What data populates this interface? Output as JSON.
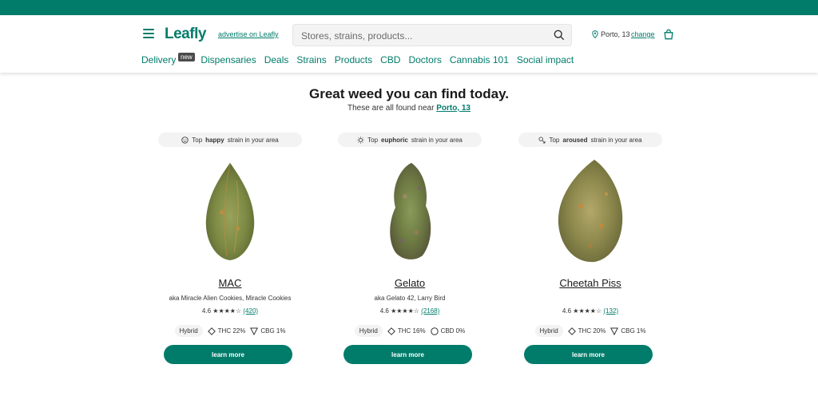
{
  "colors": {
    "brand": "#017c6b",
    "badge": "#4a4a4a"
  },
  "header": {
    "logo": "Leafly",
    "advertise": "advertise on Leafly",
    "search_placeholder": "Stores, strains, products...",
    "location": "Porto, 13",
    "change": "change",
    "icons": [
      "menu-icon",
      "search-icon",
      "location-pin-icon",
      "shopping-bag-icon"
    ]
  },
  "nav": {
    "items": [
      "Delivery",
      "Dispensaries",
      "Deals",
      "Strains",
      "Products",
      "CBD",
      "Doctors",
      "Cannabis 101",
      "Social impact"
    ],
    "badge": "new"
  },
  "hero": {
    "title": "Great weed you can find today.",
    "subtitle_prefix": "These are all found near",
    "subtitle_link": "Porto, 13"
  },
  "cards": [
    {
      "tag_prefix": "Top",
      "tag_bold": "happy",
      "tag_suffix": "strain in your area",
      "tag_icon": "smiley-icon",
      "name": "MAC",
      "aka": "aka Miracle Alien Cookies, Miracle Cookies",
      "rating": "4.6",
      "count": "(420)",
      "type": "Hybrid",
      "thc": "THC 22%",
      "cb": "CBG 1%",
      "cb_icon": "triangle-icon",
      "button": "learn more"
    },
    {
      "tag_prefix": "Top",
      "tag_bold": "euphoric",
      "tag_suffix": "strain in your area",
      "tag_icon": "sun-icon",
      "name": "Gelato",
      "aka": "aka Gelato 42, Larry Bird",
      "rating": "4.6",
      "count": "(2168)",
      "type": "Hybrid",
      "thc": "THC 16%",
      "cb": "CBD 0%",
      "cb_icon": "circle-icon",
      "button": "learn more"
    },
    {
      "tag_prefix": "Top",
      "tag_bold": "aroused",
      "tag_suffix": "strain in your area",
      "tag_icon": "aroused-icon",
      "name": "Cheetah Piss",
      "aka": "",
      "rating": "4.6",
      "count": "(132)",
      "type": "Hybrid",
      "thc": "THC 20%",
      "cb": "CBG 1%",
      "cb_icon": "triangle-icon",
      "button": "learn more"
    }
  ]
}
